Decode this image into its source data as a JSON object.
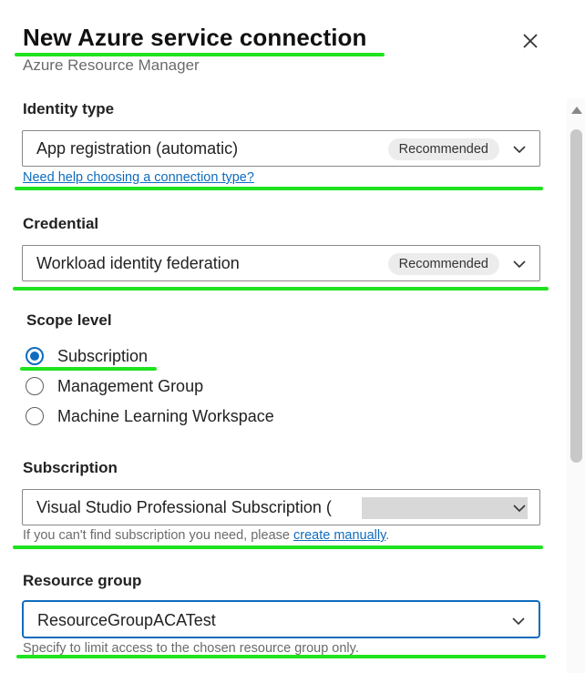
{
  "header": {
    "title": "New Azure service connection",
    "subtitle": "Azure Resource Manager"
  },
  "identity_type": {
    "label": "Identity type",
    "value": "App registration (automatic)",
    "badge": "Recommended",
    "help_link": "Need help choosing a connection type?"
  },
  "credential": {
    "label": "Credential",
    "value": "Workload identity federation",
    "badge": "Recommended"
  },
  "scope_level": {
    "label": "Scope level",
    "options": [
      "Subscription",
      "Management Group",
      "Machine Learning Workspace"
    ],
    "selected": "Subscription"
  },
  "subscription": {
    "label": "Subscription",
    "value": "Visual Studio Professional Subscription (",
    "helper_prefix": "If you can't find subscription you need, please ",
    "helper_link": "create manually",
    "helper_suffix": "."
  },
  "resource_group": {
    "label": "Resource group",
    "value": "ResourceGroupACATest",
    "helper": "Specify to limit access to the chosen resource group only."
  },
  "colors": {
    "accent": "#0f6cbd",
    "highlight": "#1fe31f"
  },
  "icons": [
    "close-icon",
    "chevron-down-icon",
    "scroll-up-icon"
  ]
}
